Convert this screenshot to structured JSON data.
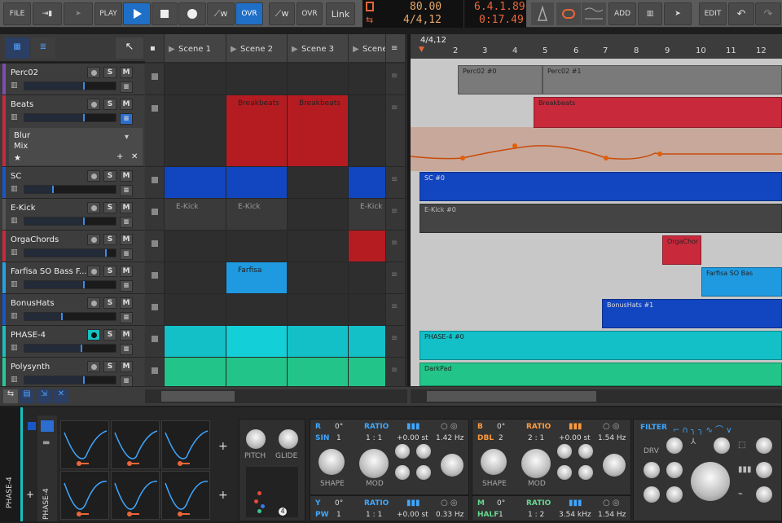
{
  "toolbar": {
    "file": "FILE",
    "play": "PLAY",
    "ovr": "OVR",
    "ovr2": "OVR",
    "link": "Link",
    "add": "ADD",
    "edit": "EDIT"
  },
  "transport": {
    "tempo": "80.00",
    "signature": "4/4,12",
    "position": "6.4.1.89",
    "time": "0:17.49"
  },
  "scenes": [
    "Scene 1",
    "Scene 2",
    "Scene 3",
    "Scene"
  ],
  "tracks": [
    {
      "name": "Perc02",
      "color": "#7a4fb0"
    },
    {
      "name": "Beats",
      "color": "#c82a3c"
    },
    {
      "name": "SC",
      "color": "#1857c8"
    },
    {
      "name": "E-Kick",
      "color": "#555555"
    },
    {
      "name": "OrgaChords",
      "color": "#c82a3c"
    },
    {
      "name": "Farfisa SO Bass F...",
      "color": "#25a0e8"
    },
    {
      "name": "BonusHats",
      "color": "#1857c8"
    },
    {
      "name": "PHASE-4",
      "color": "#18c0c0"
    },
    {
      "name": "Polysynth",
      "color": "#26c89a"
    }
  ],
  "beats_device": {
    "name": "Blur",
    "param": "Mix"
  },
  "clips": {
    "breakbeats1": "Breakbeats",
    "breakbeats2": "Breakbeats",
    "ekick1": "E-Kick",
    "ekick2": "E-Kick",
    "ekick3": "E-Kick",
    "farfisa": "Farfisa"
  },
  "ruler": {
    "signature": "4/4,12",
    "ticks": [
      "2",
      "3",
      "4",
      "5",
      "6",
      "7",
      "8",
      "9",
      "10",
      "11",
      "12"
    ]
  },
  "arranger_clips": {
    "perc1": "Perc02 #0",
    "perc2": "Perc02 #1",
    "breakbeats": "Breakbeats",
    "sc": "SC #0",
    "ekick": "E-Kick #0",
    "orga": "OrgaChor",
    "farfisa": "Farfisa SO Bas",
    "bonushats": "BonusHats #1",
    "phase": "PHASE-4 #0",
    "darkpad": "DarkPad"
  },
  "device": {
    "track_label": "PHASE-4",
    "vert_label": "PHASE-4",
    "pitch": "PITCH",
    "glide": "GLIDE",
    "voices": "4",
    "osc_r": {
      "letter": "R",
      "deg": "0°",
      "ratio_label": "RATIO",
      "wave": "SIN",
      "num": "1",
      "ratio": "1 : 1",
      "st": "+0.00 st",
      "hz": "1.42 Hz",
      "shape": "SHAPE",
      "mod": "MOD"
    },
    "osc_b": {
      "letter": "B",
      "deg": "0°",
      "ratio_label": "RATIO",
      "wave": "DBL",
      "num": "2",
      "ratio": "2 : 1",
      "st": "+0.00 st",
      "hz": "1.54 Hz",
      "shape": "SHAPE",
      "mod": "MOD"
    },
    "osc_y": {
      "letter": "Y",
      "deg": "0°",
      "ratio_label": "RATIO",
      "wave": "PW",
      "num": "1",
      "ratio": "1 : 1",
      "st": "+0.00 st",
      "hz": "0.33 Hz"
    },
    "osc_m": {
      "letter": "M",
      "deg": "0°",
      "ratio_label": "RATIO",
      "wave": "HALF",
      "num": "1",
      "ratio": "1 : 2",
      "st": "3.54 kHz",
      "hz": "1.54 Hz"
    },
    "filter": {
      "title": "FILTER",
      "drv": "DRV"
    }
  },
  "colors": {
    "accent": "#1f6fc7",
    "orange": "#e8a66a"
  }
}
